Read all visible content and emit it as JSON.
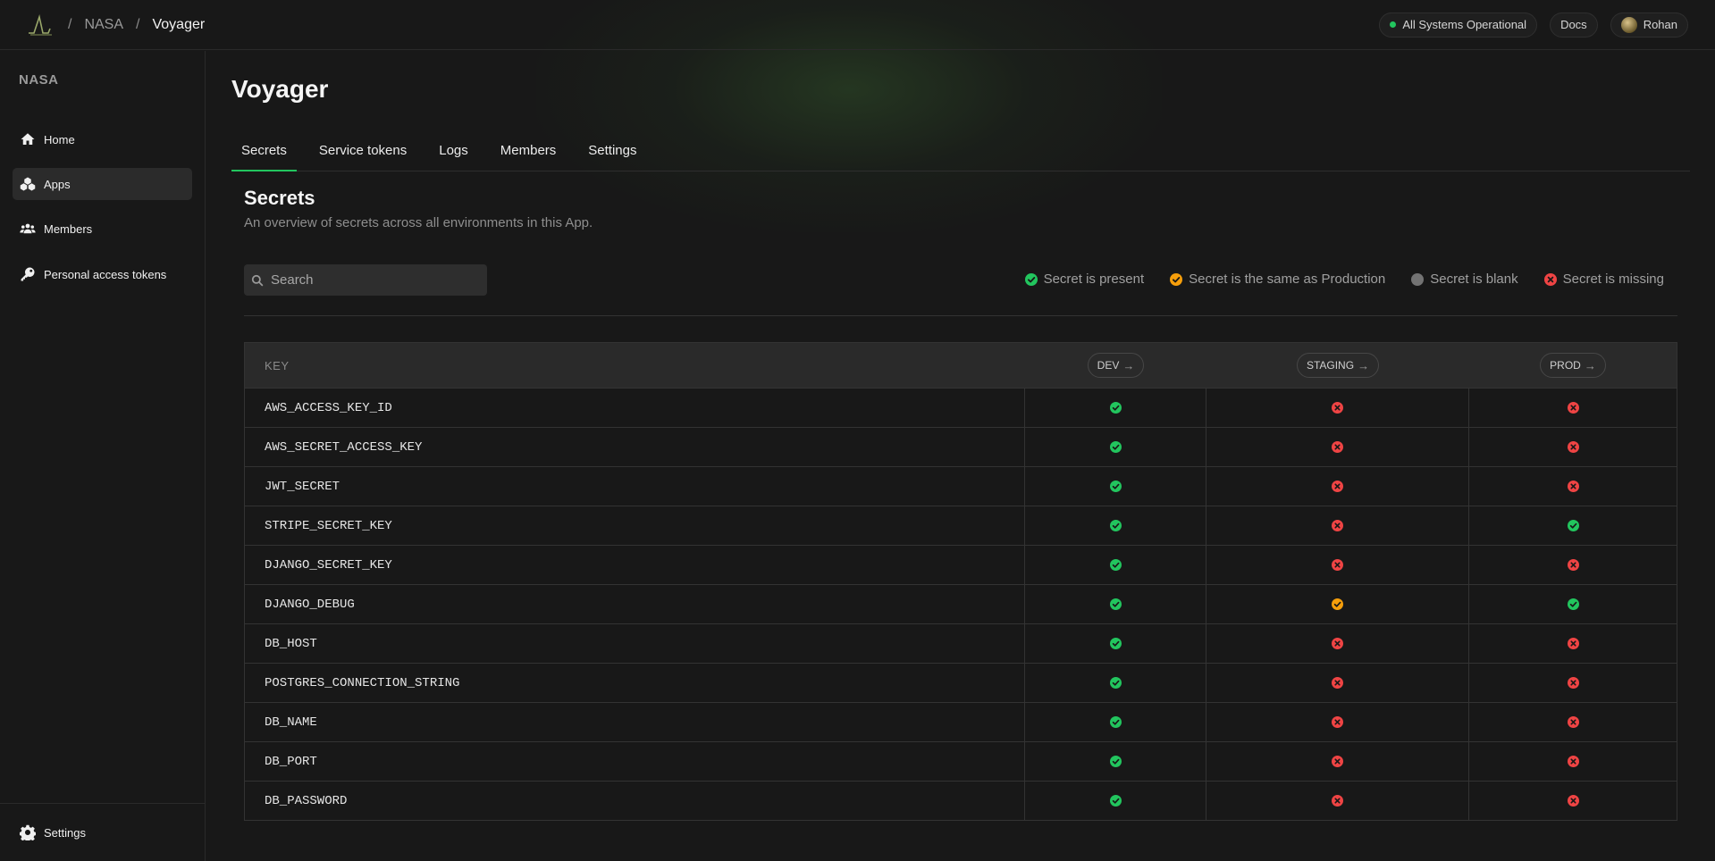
{
  "topbar": {
    "breadcrumbs": [
      "NASA",
      "Voyager"
    ],
    "status_label": "All Systems Operational",
    "docs_label": "Docs",
    "user_name": "Rohan"
  },
  "sidebar": {
    "org_name": "NASA",
    "items": [
      {
        "label": "Home",
        "icon": "home-icon"
      },
      {
        "label": "Apps",
        "icon": "apps-icon",
        "active": true
      },
      {
        "label": "Members",
        "icon": "members-icon"
      },
      {
        "label": "Personal access tokens",
        "icon": "key-icon"
      }
    ],
    "settings_label": "Settings"
  },
  "main": {
    "title": "Voyager",
    "tabs": [
      {
        "label": "Secrets",
        "active": true
      },
      {
        "label": "Service tokens"
      },
      {
        "label": "Logs"
      },
      {
        "label": "Members"
      },
      {
        "label": "Settings"
      }
    ],
    "section_title": "Secrets",
    "section_desc": "An overview of secrets across all environments in this App.",
    "search_placeholder": "Search",
    "legend": [
      {
        "label": "Secret is present",
        "status": "present"
      },
      {
        "label": "Secret is the same as Production",
        "status": "same"
      },
      {
        "label": "Secret is blank",
        "status": "blank"
      },
      {
        "label": "Secret is missing",
        "status": "missing"
      }
    ]
  },
  "table": {
    "key_header": "KEY",
    "envs": [
      "DEV",
      "STAGING",
      "PROD"
    ],
    "rows": [
      {
        "key": "AWS_ACCESS_KEY_ID",
        "status": [
          "present",
          "missing",
          "missing"
        ]
      },
      {
        "key": "AWS_SECRET_ACCESS_KEY",
        "status": [
          "present",
          "missing",
          "missing"
        ]
      },
      {
        "key": "JWT_SECRET",
        "status": [
          "present",
          "missing",
          "missing"
        ]
      },
      {
        "key": "STRIPE_SECRET_KEY",
        "status": [
          "present",
          "missing",
          "present"
        ]
      },
      {
        "key": "DJANGO_SECRET_KEY",
        "status": [
          "present",
          "missing",
          "missing"
        ]
      },
      {
        "key": "DJANGO_DEBUG",
        "status": [
          "present",
          "same",
          "present"
        ]
      },
      {
        "key": "DB_HOST",
        "status": [
          "present",
          "missing",
          "missing"
        ]
      },
      {
        "key": "POSTGRES_CONNECTION_STRING",
        "status": [
          "present",
          "missing",
          "missing"
        ]
      },
      {
        "key": "DB_NAME",
        "status": [
          "present",
          "missing",
          "missing"
        ]
      },
      {
        "key": "DB_PORT",
        "status": [
          "present",
          "missing",
          "missing"
        ]
      },
      {
        "key": "DB_PASSWORD",
        "status": [
          "present",
          "missing",
          "missing"
        ]
      }
    ]
  },
  "colors": {
    "present": "#22c55e",
    "same": "#f59e0b",
    "blank": "#737373",
    "missing": "#ef4444",
    "accent": "#22c55e"
  }
}
